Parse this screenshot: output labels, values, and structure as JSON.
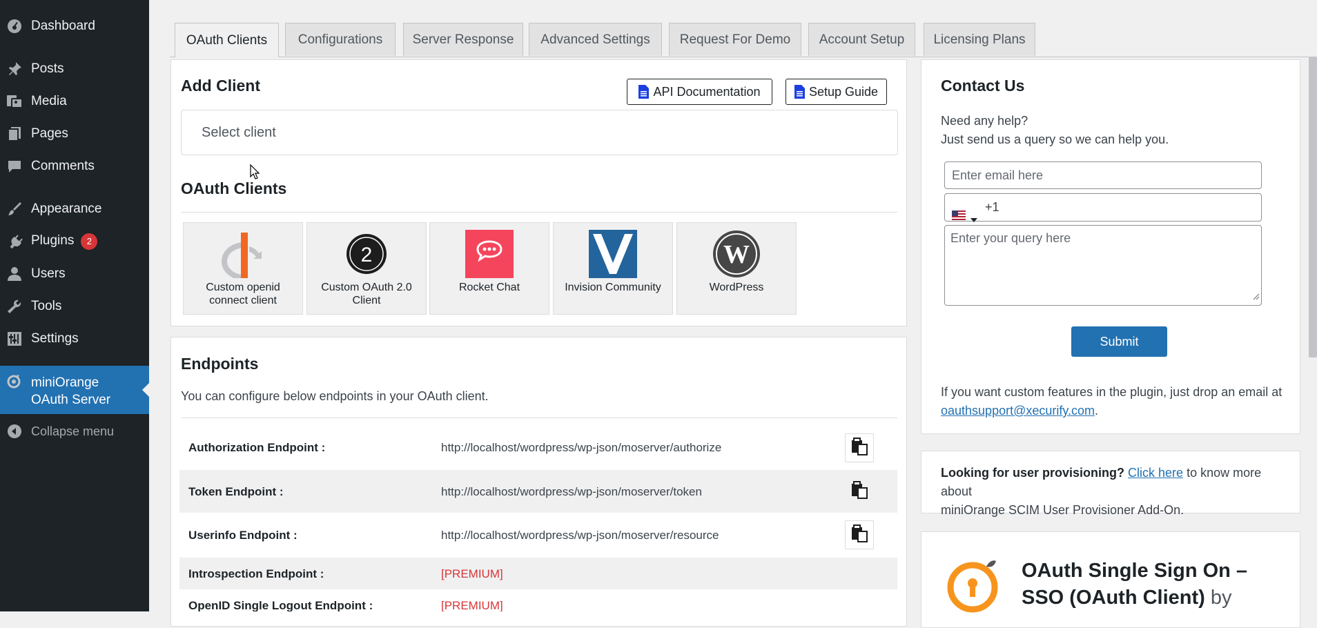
{
  "sidebar": {
    "items": [
      {
        "label": "Dashboard",
        "icon": "dashboard-icon"
      },
      {
        "label": "Posts",
        "icon": "pin-icon"
      },
      {
        "label": "Media",
        "icon": "media-icon"
      },
      {
        "label": "Pages",
        "icon": "pages-icon"
      },
      {
        "label": "Comments",
        "icon": "comments-icon"
      },
      {
        "label": "Appearance",
        "icon": "brush-icon"
      },
      {
        "label": "Plugins",
        "icon": "plugin-icon",
        "badge": "2"
      },
      {
        "label": "Users",
        "icon": "user-icon"
      },
      {
        "label": "Tools",
        "icon": "wrench-icon"
      },
      {
        "label": "Settings",
        "icon": "settings-icon"
      }
    ],
    "active": {
      "line1": "miniOrange",
      "line2": "OAuth Server"
    },
    "collapse": "Collapse menu"
  },
  "tabs": [
    "OAuth Clients",
    "Configurations",
    "Server Response",
    "Advanced Settings",
    "Request For Demo",
    "Account Setup",
    "Licensing Plans"
  ],
  "add_client": {
    "title": "Add Client",
    "api_doc_label": "API Documentation",
    "setup_guide_label": "Setup Guide",
    "select_placeholder": "Select client"
  },
  "oauth_clients": {
    "title": "OAuth Clients",
    "cards": [
      {
        "line1": "Custom openid",
        "line2": "connect client"
      },
      {
        "line1": "Custom OAuth 2.0",
        "line2": "Client"
      },
      {
        "line1": "Rocket Chat",
        "line2": ""
      },
      {
        "line1": "Invision Community",
        "line2": ""
      },
      {
        "line1": "WordPress",
        "line2": ""
      }
    ]
  },
  "endpoints": {
    "title": "Endpoints",
    "subtitle": "You can configure below endpoints in your OAuth client.",
    "rows": [
      {
        "label": "Authorization Endpoint :",
        "value": "http://localhost/wordpress/wp-json/moserver/authorize"
      },
      {
        "label": "Token Endpoint :",
        "value": "http://localhost/wordpress/wp-json/moserver/token"
      },
      {
        "label": "Userinfo Endpoint :",
        "value": "http://localhost/wordpress/wp-json/moserver/resource"
      },
      {
        "label": "Introspection Endpoint :",
        "value": "[PREMIUM]"
      },
      {
        "label": "OpenID Single Logout Endpoint :",
        "value": "[PREMIUM]"
      }
    ]
  },
  "contact": {
    "title": "Contact Us",
    "help_line1": "Need any help?",
    "help_line2": "Just send us a query so we can help you.",
    "email_placeholder": "Enter email here",
    "phone_prefix": "+1",
    "query_placeholder": "Enter your query here",
    "submit_label": "Submit",
    "custom_text": "If you want custom features in the plugin, just drop an email at",
    "email_link": "oauthsupport@xecurify.com",
    "email_link_suffix": "."
  },
  "provisioning": {
    "bold": "Looking for user provisioning?",
    "link": "Click here",
    "rest1": " to know more about",
    "rest2": "miniOrange SCIM User Provisioner Add-On."
  },
  "promo": {
    "title_line1": "OAuth Single Sign On –",
    "title_line2": "SSO (OAuth Client)",
    "title_suffix": " by"
  },
  "colors": {
    "accent": "#2271b1",
    "sidebar": "#1d2327",
    "premium": "#d63638",
    "promo_orange": "#f7941d"
  }
}
